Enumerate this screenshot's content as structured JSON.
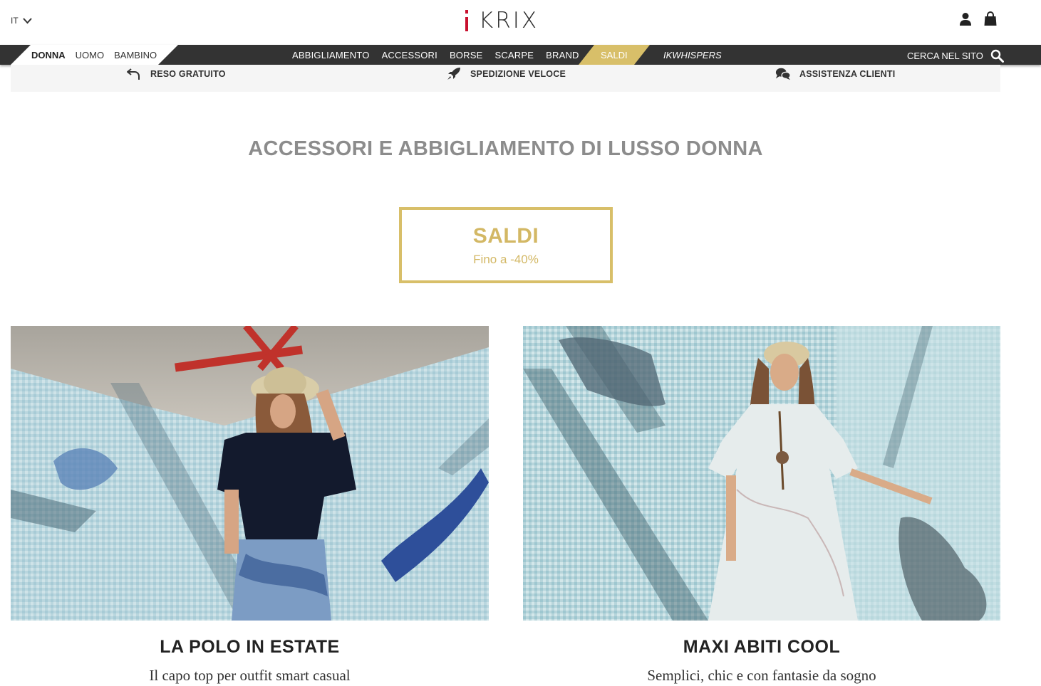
{
  "header": {
    "language": "IT",
    "logo_text": "KRIX",
    "icons": [
      "user-icon",
      "shopping-bag-icon",
      "chevron-down-icon"
    ]
  },
  "gender_nav": {
    "items": [
      {
        "label": "DONNA",
        "active": true
      },
      {
        "label": "UOMO",
        "active": false
      },
      {
        "label": "BAMBINO",
        "active": false
      }
    ]
  },
  "main_nav": {
    "items": [
      {
        "label": "ABBIGLIAMENTO"
      },
      {
        "label": "ACCESSORI"
      },
      {
        "label": "BORSE"
      },
      {
        "label": "SCARPE"
      },
      {
        "label": "BRAND"
      }
    ],
    "sale_label": "SALDI",
    "whispers_label": "IKWHISPERS",
    "search_label": "CERCA NEL SITO"
  },
  "services": [
    {
      "label": "RESO GRATUITO",
      "icon": "return-arrow-icon"
    },
    {
      "label": "SPEDIZIONE VELOCE",
      "icon": "rocket-icon"
    },
    {
      "label": "ASSISTENZA CLIENTI",
      "icon": "chat-bubbles-icon"
    }
  ],
  "page_title": "ACCESSORI E ABBIGLIAMENTO DI LUSSO DONNA",
  "sale_banner": {
    "title": "SALDI",
    "subtitle": "Fino a -40%"
  },
  "cards": [
    {
      "title": "LA POLO IN ESTATE",
      "subtitle": "Il capo top per outfit smart casual"
    },
    {
      "title": "MAXI ABITI COOL",
      "subtitle": "Semplici, chic e con fantasie da sogno"
    }
  ],
  "colors": {
    "nav_bg": "#333333",
    "gold": "#d8bf69",
    "title_grey": "#8c8c8c",
    "logo_red": "#c8102e"
  }
}
